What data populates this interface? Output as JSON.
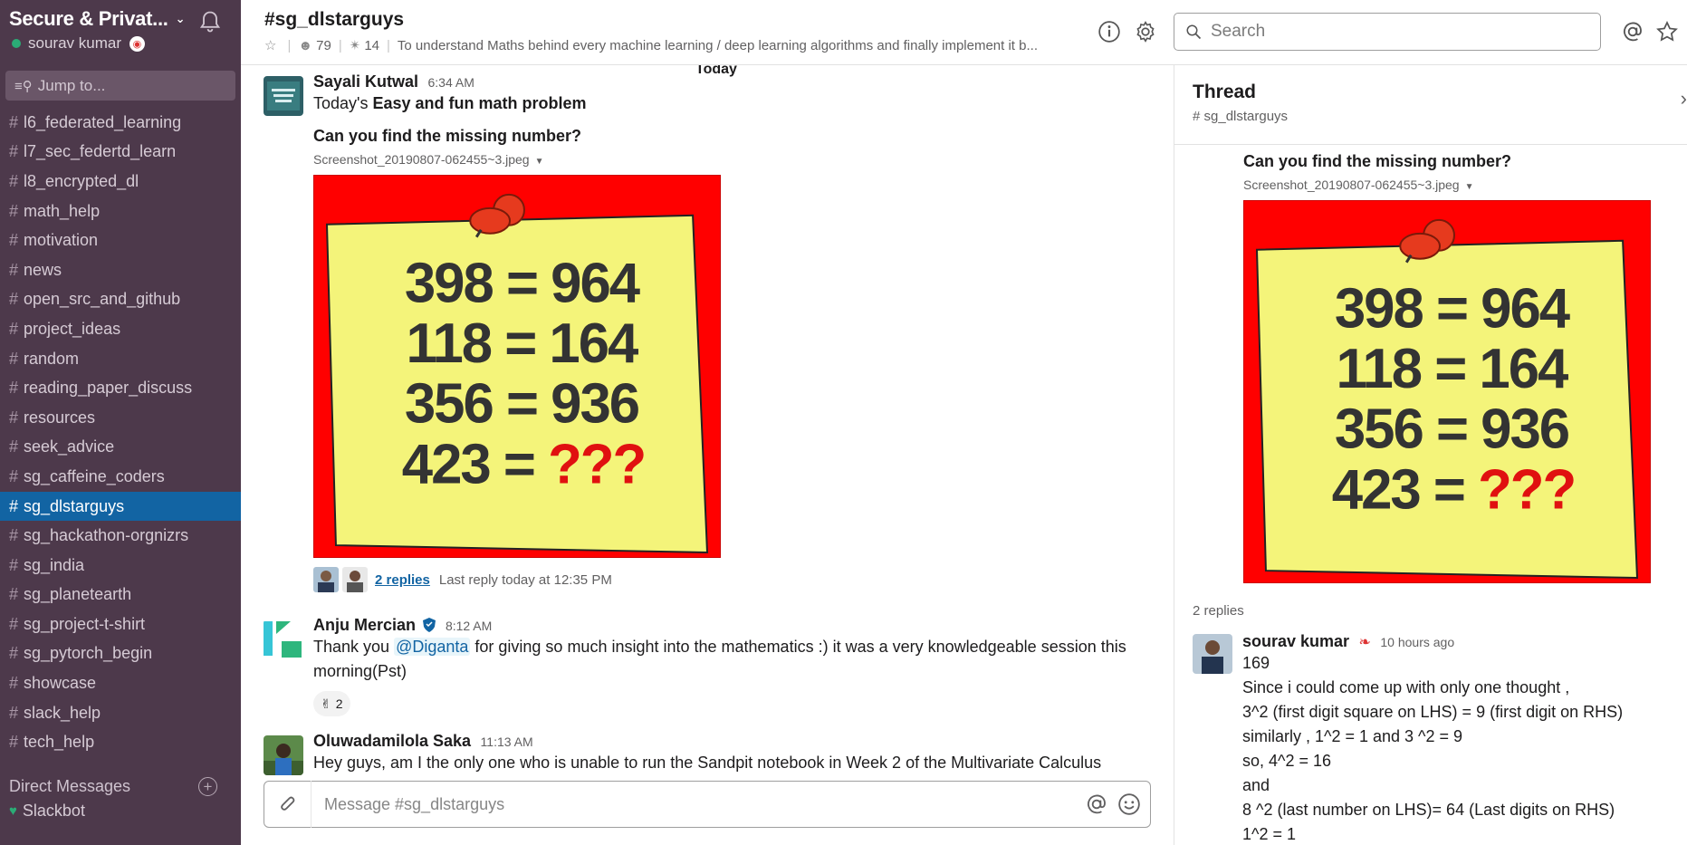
{
  "workspace": {
    "name": "Secure & Privat...",
    "user": "sourav kumar"
  },
  "sidebar": {
    "jump_label": "Jump to...",
    "channels": [
      {
        "name": "l6_federated_learning"
      },
      {
        "name": "l7_sec_federtd_learn"
      },
      {
        "name": "l8_encrypted_dl"
      },
      {
        "name": "math_help"
      },
      {
        "name": "motivation"
      },
      {
        "name": "news"
      },
      {
        "name": "open_src_and_github"
      },
      {
        "name": "project_ideas"
      },
      {
        "name": "random"
      },
      {
        "name": "reading_paper_discuss"
      },
      {
        "name": "resources"
      },
      {
        "name": "seek_advice"
      },
      {
        "name": "sg_caffeine_coders"
      },
      {
        "name": "sg_dlstarguys",
        "active": true
      },
      {
        "name": "sg_hackathon-orgnizrs"
      },
      {
        "name": "sg_india"
      },
      {
        "name": "sg_planetearth"
      },
      {
        "name": "sg_project-t-shirt"
      },
      {
        "name": "sg_pytorch_begin"
      },
      {
        "name": "showcase"
      },
      {
        "name": "slack_help"
      },
      {
        "name": "tech_help"
      }
    ],
    "dm_title": "Direct Messages",
    "dms": [
      {
        "name": "Slackbot"
      }
    ]
  },
  "header": {
    "channel_title": "#sg_dlstarguys",
    "members": "79",
    "pins": "14",
    "topic": "To understand Maths behind every machine learning / deep learning algorithms and finally implement it b...",
    "search_placeholder": "Search"
  },
  "divider_label": "Today",
  "messages": [
    {
      "author": "Sayali Kutwal",
      "time": "6:34 AM",
      "text_prefix": "Today's ",
      "text_bold": "Easy and fun math problem",
      "question": "Can you find the missing number?",
      "file_name": "Screenshot_20190807-062455~3.jpeg",
      "replies_label": "2 replies",
      "last_reply": "Last reply today at 12:35 PM"
    },
    {
      "author": "Anju Mercian",
      "time": "8:12 AM",
      "text_a": "Thank you ",
      "mention": "@Diganta",
      "text_b": " for giving so much insight into the mathematics :) it was a very knowledgeable session this morning(Pst)",
      "reaction_count": "2"
    },
    {
      "author": "Oluwadamilola Saka",
      "time": "11:13 AM",
      "text": "Hey guys, am I the only one who is unable to run the Sandpit notebook in Week 2 of the Multivariate Calculus"
    }
  ],
  "puzzle": {
    "lines": [
      "398 = 964",
      "118 = 164",
      "356 = 936"
    ],
    "last_lhs": "423 = ",
    "last_rhs": "???"
  },
  "composer": {
    "placeholder": "Message #sg_dlstarguys"
  },
  "thread": {
    "title": "Thread",
    "channel": "# sg_dlstarguys",
    "question": "Can you find the missing number?",
    "file_name": "Screenshot_20190807-062455~3.jpeg",
    "reply_count": "2 replies",
    "reply": {
      "author": "sourav kumar",
      "time": "10 hours ago",
      "lines": [
        "169",
        "Since i could come up with only one thought ,",
        "3^2 (first digit square on LHS) = 9 (first digit on RHS)",
        "similarly , 1^2 = 1 and 3 ^2 = 9",
        "so, 4^2 = 16",
        "and",
        "8 ^2 (last number on LHS)= 64 (Last digits on RHS)",
        "1^2 = 1"
      ]
    }
  },
  "colors": {
    "sidebar_bg": "#4d394b",
    "active_channel": "#1264a3",
    "link": "#1264a3",
    "presence": "#2bac76",
    "puzzle_red": "#ff0000",
    "note_yellow": "#f4f47a"
  }
}
